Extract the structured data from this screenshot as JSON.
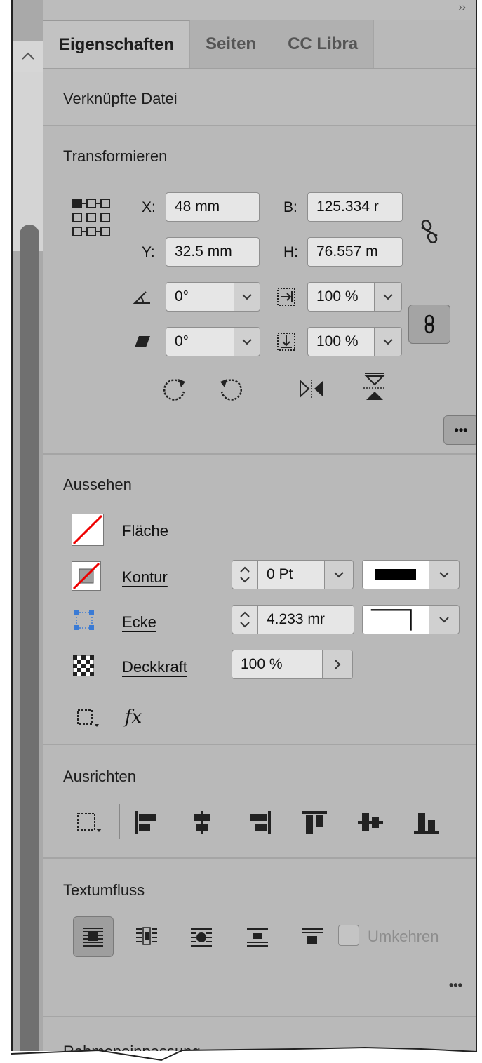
{
  "panel": {
    "more_chevron": "››",
    "tabs": [
      {
        "label": "Eigenschaften",
        "active": true
      },
      {
        "label": "Seiten",
        "active": false
      },
      {
        "label": "CC Libra",
        "active": false
      }
    ]
  },
  "linked_file": {
    "title": "Verknüpfte Datei"
  },
  "transform": {
    "title": "Transformieren",
    "x_label": "X:",
    "x_value": "48 mm",
    "y_label": "Y:",
    "y_value": "32.5 mm",
    "w_label": "B:",
    "w_value": "125.334 r",
    "h_label": "H:",
    "h_value": "76.557 m",
    "rotation_value": "0°",
    "shear_value": "0°",
    "scale_x_value": "100 %",
    "scale_y_value": "100 %",
    "more_label": "•••"
  },
  "appearance": {
    "title": "Aussehen",
    "fill_label": "Fläche",
    "stroke_label": "Kontur",
    "stroke_weight": "0 Pt",
    "corner_label": "Ecke",
    "corner_value": "4.233 mr",
    "opacity_label": "Deckkraft",
    "opacity_value": "100 %",
    "fx_label": "fx"
  },
  "align": {
    "title": "Ausrichten"
  },
  "text_wrap": {
    "title": "Textumfluss",
    "invert_label": "Umkehren",
    "more_label": "•••"
  },
  "frame_fitting": {
    "title": "Rahmeneinpassung"
  }
}
